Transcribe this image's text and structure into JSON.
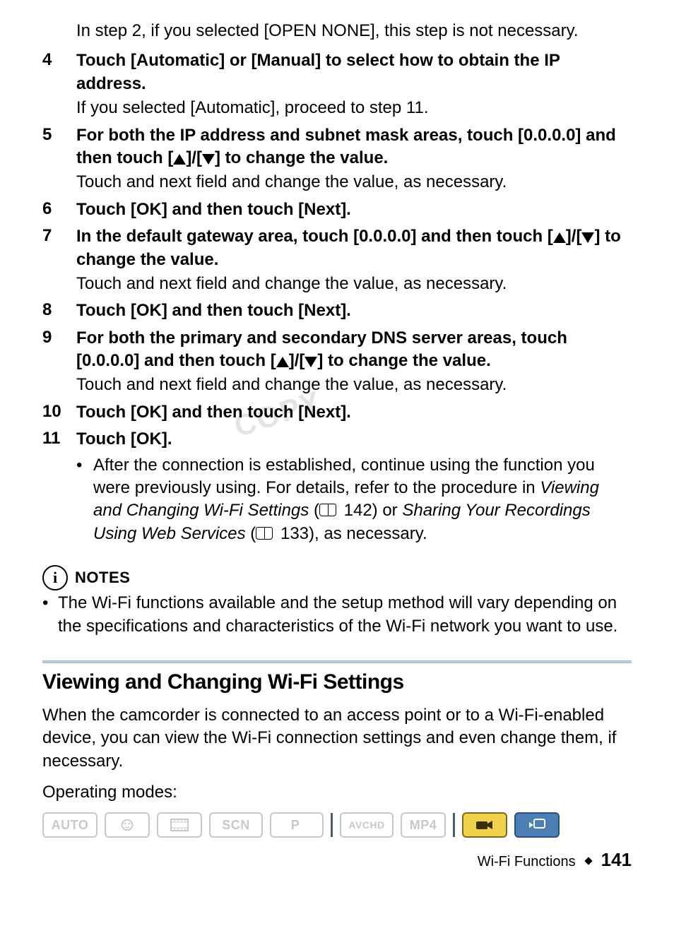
{
  "intro_indent": "In step 2, if you selected [OPEN NONE], this step is not necessary.",
  "steps": {
    "s4": {
      "num": "4",
      "bold": "Touch [Automatic] or [Manual] to select how to obtain the IP address.",
      "sub": "If you selected [Automatic], proceed to step 11."
    },
    "s5": {
      "num": "5",
      "bold_a": "For both the IP address and subnet mask areas, touch [0.0.0.0] and then touch [",
      "bold_b": "]/[",
      "bold_c": "] to change the value.",
      "sub": "Touch and next field and change the value, as necessary."
    },
    "s6": {
      "num": "6",
      "bold": "Touch [OK] and then touch [Next]."
    },
    "s7": {
      "num": "7",
      "bold_a": "In the default gateway area, touch [0.0.0.0] and then touch [",
      "bold_b": "]/[",
      "bold_c": "] to change the value.",
      "sub": "Touch and next field and change the value, as necessary."
    },
    "s8": {
      "num": "8",
      "bold": "Touch [OK] and then touch [Next]."
    },
    "s9": {
      "num": "9",
      "bold_a": "For both the primary and secondary DNS server areas, touch [0.0.0.0] and then touch [",
      "bold_b": "]/[",
      "bold_c": "] to change the value.",
      "sub": "Touch and next field and change the value, as necessary."
    },
    "s10": {
      "num": "10",
      "bold": "Touch [OK] and then touch [Next]."
    },
    "s11": {
      "num": "11",
      "bold": "Touch [OK].",
      "bullet_a": "After the connection is established, continue using the function you were previously using. For details, refer to the procedure in ",
      "bullet_i1": "Viewing and Changing Wi-Fi Settings",
      "bullet_b": " (",
      "bullet_ref1": " 142) or ",
      "bullet_i2": "Sharing Your Recordings Using Web Services",
      "bullet_c": " (",
      "bullet_ref2": " 133), as necessary."
    }
  },
  "watermark": "COPY",
  "notes": {
    "label": "NOTES",
    "text": "The Wi-Fi functions available and the setup method will vary depending on the specifications and characteristics of the Wi-Fi network you want to use."
  },
  "section": {
    "title": "Viewing and Changing Wi-Fi Settings",
    "para": "When the camcorder is connected to an access point or to a Wi-Fi-enabled device, you can view the Wi-Fi connection settings and even change them, if necessary.",
    "op_label": "Operating modes:"
  },
  "modes": {
    "auto": "AUTO",
    "scn": "SCN",
    "p": "P",
    "avchd": "AVCHD",
    "mp4": "MP4"
  },
  "footer": {
    "section": "Wi-Fi Functions",
    "page": "141"
  }
}
